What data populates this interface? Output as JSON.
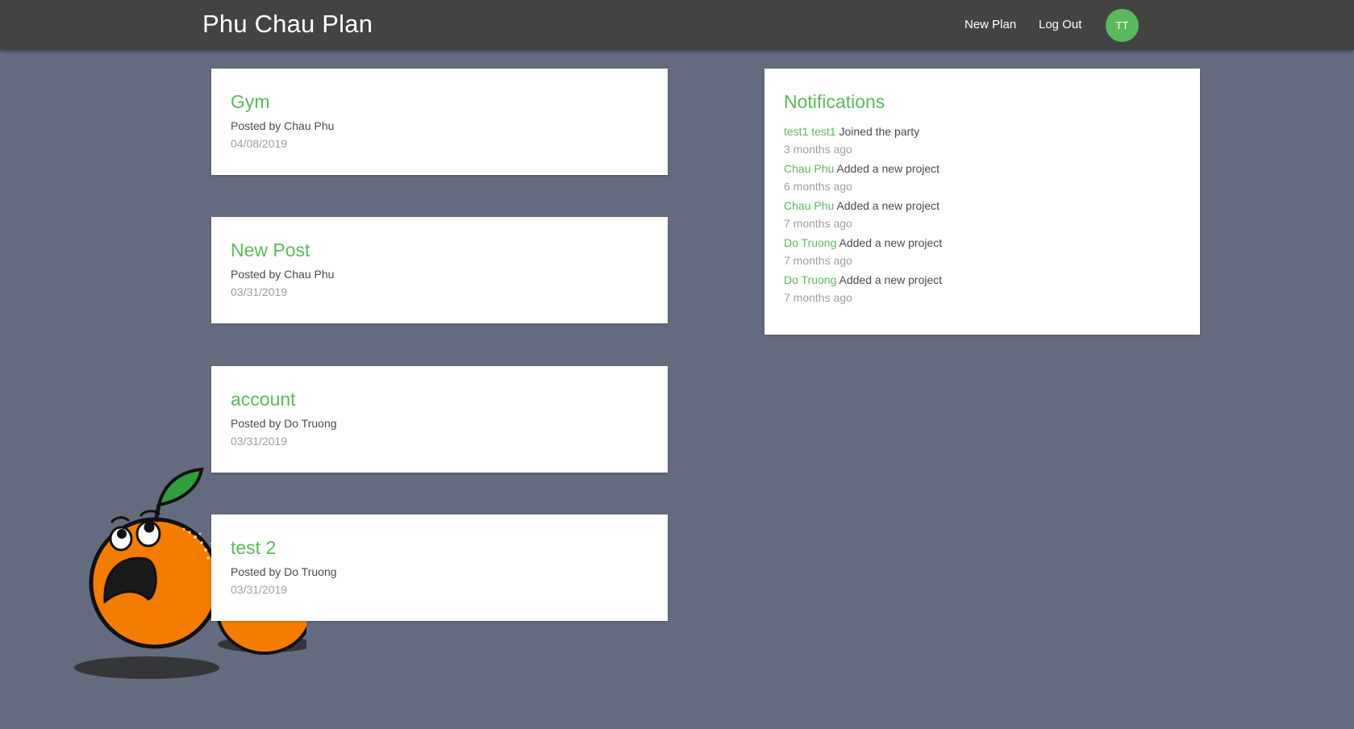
{
  "navbar": {
    "brand": "Phu Chau Plan",
    "links": {
      "new_plan": "New Plan",
      "log_out": "Log Out"
    },
    "avatar_initials": "TT"
  },
  "plans": [
    {
      "title": "Gym",
      "author": "Posted by Chau Phu",
      "date": "04/08/2019"
    },
    {
      "title": "New Post",
      "author": "Posted by Chau Phu",
      "date": "03/31/2019"
    },
    {
      "title": "account",
      "author": "Posted by Do Truong",
      "date": "03/31/2019"
    },
    {
      "title": "test 2",
      "author": "Posted by Do Truong",
      "date": "03/31/2019"
    }
  ],
  "notifications": {
    "title": "Notifications",
    "items": [
      {
        "user": "test1 test1",
        "action": "Joined the party",
        "time": "3 months ago"
      },
      {
        "user": "Chau Phu",
        "action": "Added a new project",
        "time": "6 months ago"
      },
      {
        "user": "Chau Phu",
        "action": "Added a new project",
        "time": "7 months ago"
      },
      {
        "user": "Do Truong",
        "action": "Added a new project",
        "time": "7 months ago"
      },
      {
        "user": "Do Truong",
        "action": "Added a new project",
        "time": "7 months ago"
      }
    ]
  },
  "colors": {
    "background": "#646b7e",
    "navbar": "#434343",
    "accent_green": "#5cb85c",
    "card": "#ffffff",
    "muted_text": "#9e9e9e"
  },
  "icons": {
    "mascot": "scared-orange-mascot-illustration"
  }
}
